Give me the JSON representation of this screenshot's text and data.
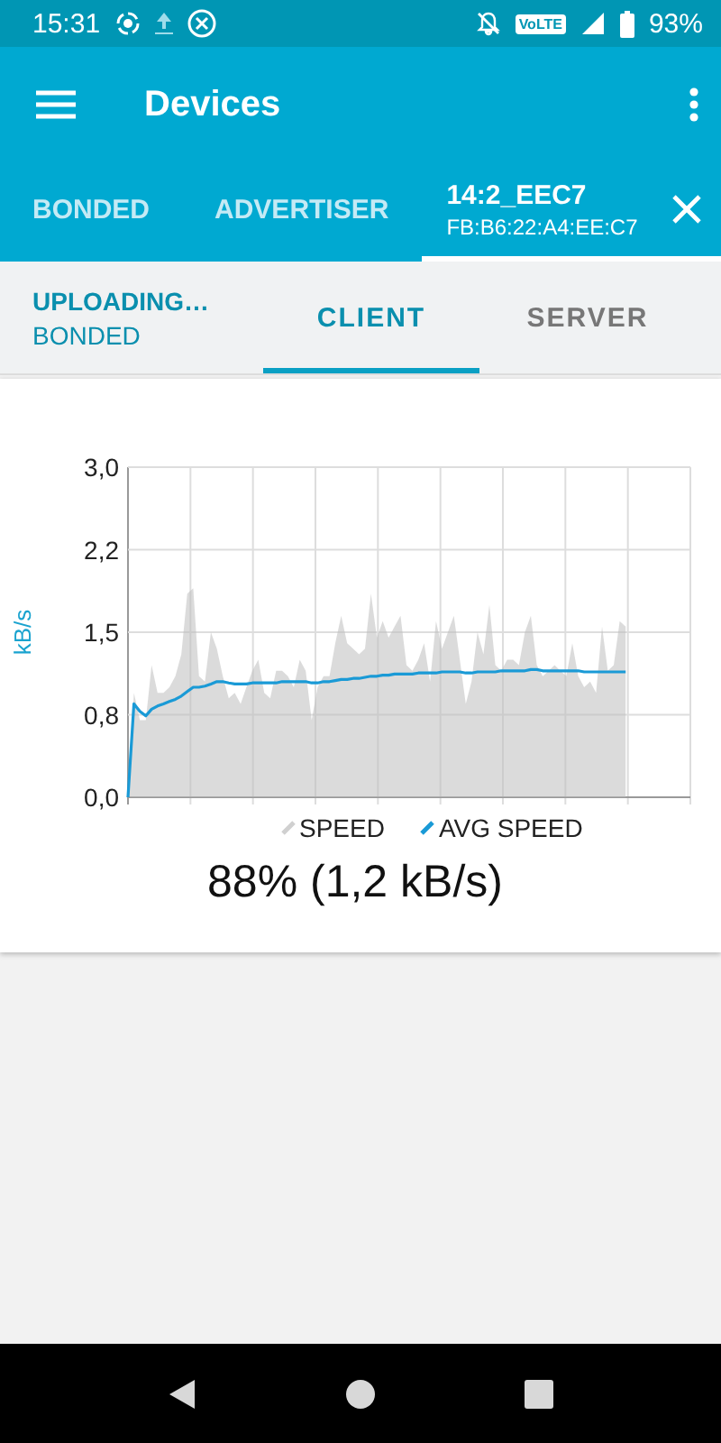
{
  "status_bar": {
    "time": "15:31",
    "volte": "VoLTE",
    "battery": "93%"
  },
  "toolbar": {
    "title": "Devices"
  },
  "tabs": [
    {
      "label": "BONDED",
      "selected": false
    },
    {
      "label": "ADVERTISER",
      "selected": false
    },
    {
      "label": "14:2_EEC7",
      "subtitle": "FB:B6:22:A4:EE:C7",
      "selected": true,
      "closable": true
    }
  ],
  "connection": {
    "state": "UPLOADING…",
    "bond": "BONDED"
  },
  "sub_tabs": [
    {
      "label": "CLIENT",
      "selected": true
    },
    {
      "label": "SERVER",
      "selected": false
    }
  ],
  "chart_data": {
    "type": "area",
    "grid": true,
    "ylabel": "kB/s",
    "ylim": [
      0,
      3
    ],
    "yticks": [
      {
        "value": 0,
        "label": "0,0"
      },
      {
        "value": 0.75,
        "label": "0,8"
      },
      {
        "value": 1.5,
        "label": "1,5"
      },
      {
        "value": 2.25,
        "label": "2,2"
      },
      {
        "value": 3,
        "label": "3,0"
      }
    ],
    "series": [
      {
        "name": "SPEED",
        "type": "area",
        "color": "#bdbdbd",
        "values": [
          0,
          0.95,
          0.7,
          0.7,
          1.2,
          0.95,
          0.95,
          1.0,
          1.1,
          1.3,
          1.85,
          1.9,
          1.1,
          1.05,
          1.5,
          1.35,
          1.1,
          0.9,
          0.95,
          0.85,
          1.0,
          1.15,
          1.25,
          0.95,
          0.9,
          1.15,
          1.15,
          1.1,
          1.0,
          1.25,
          1.15,
          0.7,
          1.0,
          1.1,
          1.1,
          1.4,
          1.65,
          1.4,
          1.35,
          1.3,
          1.35,
          1.85,
          1.45,
          1.6,
          1.45,
          1.55,
          1.65,
          1.2,
          1.15,
          1.25,
          1.4,
          1.05,
          1.6,
          1.35,
          1.5,
          1.65,
          1.25,
          0.85,
          1.05,
          1.5,
          1.3,
          1.75,
          1.2,
          1.15,
          1.25,
          1.25,
          1.2,
          1.5,
          1.65,
          1.2,
          1.1,
          1.15,
          1.2,
          1.15,
          1.1,
          1.4,
          1.1,
          1.0,
          1.05,
          0.95,
          1.55,
          1.15,
          1.2,
          1.6,
          1.55
        ]
      },
      {
        "name": "AVG SPEED",
        "type": "line",
        "color": "#1a9ad6",
        "values": [
          0,
          0.85,
          0.78,
          0.74,
          0.8,
          0.83,
          0.85,
          0.87,
          0.89,
          0.92,
          0.96,
          1.0,
          1.0,
          1.01,
          1.03,
          1.05,
          1.05,
          1.04,
          1.03,
          1.03,
          1.03,
          1.04,
          1.04,
          1.04,
          1.04,
          1.04,
          1.05,
          1.05,
          1.05,
          1.05,
          1.05,
          1.04,
          1.04,
          1.05,
          1.05,
          1.06,
          1.07,
          1.07,
          1.08,
          1.08,
          1.09,
          1.1,
          1.1,
          1.11,
          1.11,
          1.12,
          1.12,
          1.12,
          1.12,
          1.13,
          1.13,
          1.13,
          1.13,
          1.14,
          1.14,
          1.14,
          1.14,
          1.13,
          1.13,
          1.14,
          1.14,
          1.14,
          1.14,
          1.15,
          1.15,
          1.15,
          1.15,
          1.15,
          1.16,
          1.16,
          1.15,
          1.15,
          1.15,
          1.15,
          1.15,
          1.15,
          1.15,
          1.14,
          1.14,
          1.14,
          1.14,
          1.14,
          1.14,
          1.14,
          1.14
        ]
      }
    ]
  },
  "progress": "88% (1,2 kB/s)"
}
